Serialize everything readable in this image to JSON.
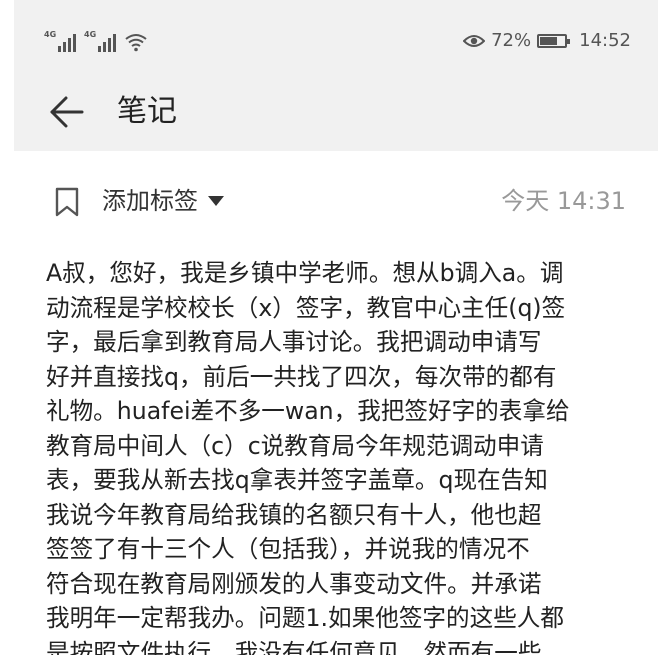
{
  "status_bar": {
    "network_1": "4G",
    "network_2": "4G",
    "battery_percent": "72%",
    "battery_level": 0.72,
    "time": "14:52",
    "icons": [
      "signal-icon",
      "signal-icon",
      "wifi-icon",
      "eye-icon",
      "battery-icon"
    ]
  },
  "app_bar": {
    "back_icon": "arrow-left-icon",
    "title": "笔记"
  },
  "tag_row": {
    "bookmark_icon": "bookmark-icon",
    "add_tag_label": "添加标签",
    "caret_icon": "caret-down-icon",
    "timestamp": "今天 14:31"
  },
  "note": {
    "lines": [
      "A叔，您好，我是乡镇中学老师。想从b调入a。调",
      "动流程是学校校长（x）签字，教官中心主任(q)签",
      "字，最后拿到教育局人事讨论。我把调动申请写",
      "好并直接找q，前后一共找了四次，每次带的都有",
      "礼物。huafei差不多一wan，我把签好字的表拿给",
      "教育局中间人（c）c说教育局今年规范调动申请",
      "表，要我从新去找q拿表并签字盖章。q现在告知",
      "我说今年教育局给我镇的名额只有十人，他也超",
      "签签了有十三个人（包括我），并说我的情况不",
      "符合现在教育局刚颁发的人事变动文件。并承诺",
      "我明年一定帮我办。问题1.如果他签字的这些人都",
      "是按照文件执行，我没有任何意见，然而有一些"
    ]
  },
  "colors": {
    "header_bg": "#f1f1f1",
    "text": "#222222",
    "muted": "#999999"
  }
}
